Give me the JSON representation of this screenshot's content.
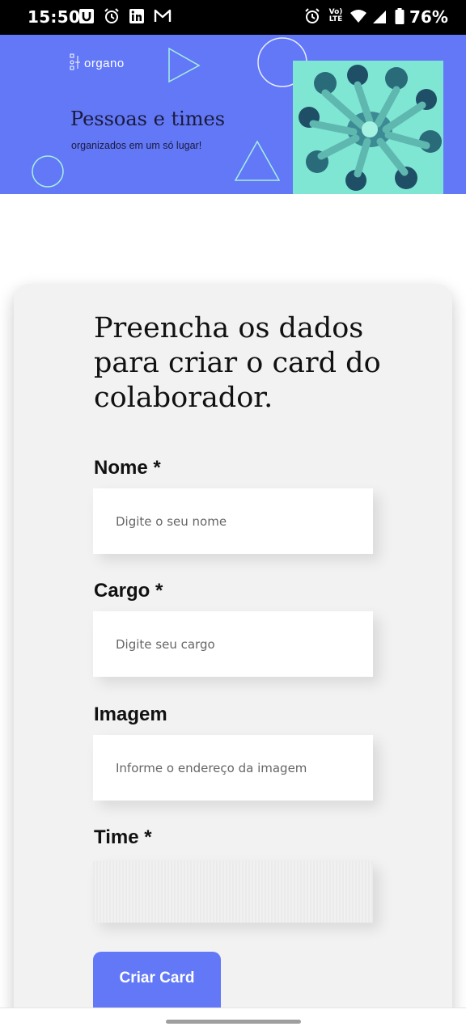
{
  "status_bar": {
    "time": "15:50",
    "network_label": "Vo) LTE",
    "battery": "76%",
    "left_icons": [
      "u-app-icon",
      "alarm-icon",
      "linkedin-icon",
      "gmail-icon"
    ],
    "right_icons": [
      "alarm-icon",
      "volte-icon",
      "wifi-icon",
      "signal-icon",
      "battery-icon"
    ]
  },
  "banner": {
    "logo": "organo",
    "title": "Pessoas e times",
    "subtitle": "organizados em um só lugar!",
    "background_color": "#6278f7",
    "photo_tint": "#7fe6d3"
  },
  "form": {
    "heading": "Preencha os dados para criar o card do colaborador.",
    "fields": {
      "nome": {
        "label": "Nome *",
        "placeholder": "Digite o seu nome"
      },
      "cargo": {
        "label": "Cargo *",
        "placeholder": "Digite seu cargo"
      },
      "imagem": {
        "label": "Imagem",
        "placeholder": "Informe o endereço da imagem"
      },
      "time": {
        "label": "Time *"
      }
    },
    "submit_label": "Criar Card",
    "accent_color": "#6278f7"
  }
}
